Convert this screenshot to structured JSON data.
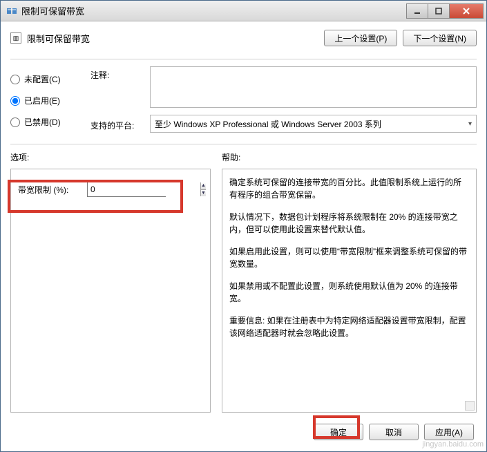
{
  "window": {
    "title": "限制可保留带宽"
  },
  "header": {
    "title": "限制可保留带宽",
    "prev": "上一个设置(P)",
    "next": "下一个设置(N)"
  },
  "config": {
    "radios": {
      "unconfigured": "未配置(C)",
      "enabled": "已启用(E)",
      "disabled": "已禁用(D)"
    },
    "comment_label": "注释:",
    "comment_value": "",
    "platform_label": "支持的平台:",
    "platform_value": "至少 Windows XP Professional 或 Windows Server 2003 系列"
  },
  "options": {
    "label": "选项:",
    "bandwidth_label": "带宽限制 (%):",
    "bandwidth_value": "0"
  },
  "help": {
    "label": "帮助:",
    "p1": "确定系统可保留的连接带宽的百分比。此值限制系统上运行的所有程序的组合带宽保留。",
    "p2": "默认情况下，数据包计划程序将系统限制在 20% 的连接带宽之内，但可以使用此设置来替代默认值。",
    "p3": "如果启用此设置，则可以使用“带宽限制”框来调整系统可保留的带宽数量。",
    "p4": "如果禁用或不配置此设置，则系统使用默认值为 20% 的连接带宽。",
    "p5": "重要信息: 如果在注册表中为特定网络适配器设置带宽限制，配置该网络适配器时就会忽略此设置。"
  },
  "buttons": {
    "ok": "确定",
    "cancel": "取消",
    "apply": "应用(A)"
  },
  "watermark": "jingyan.baidu.com"
}
